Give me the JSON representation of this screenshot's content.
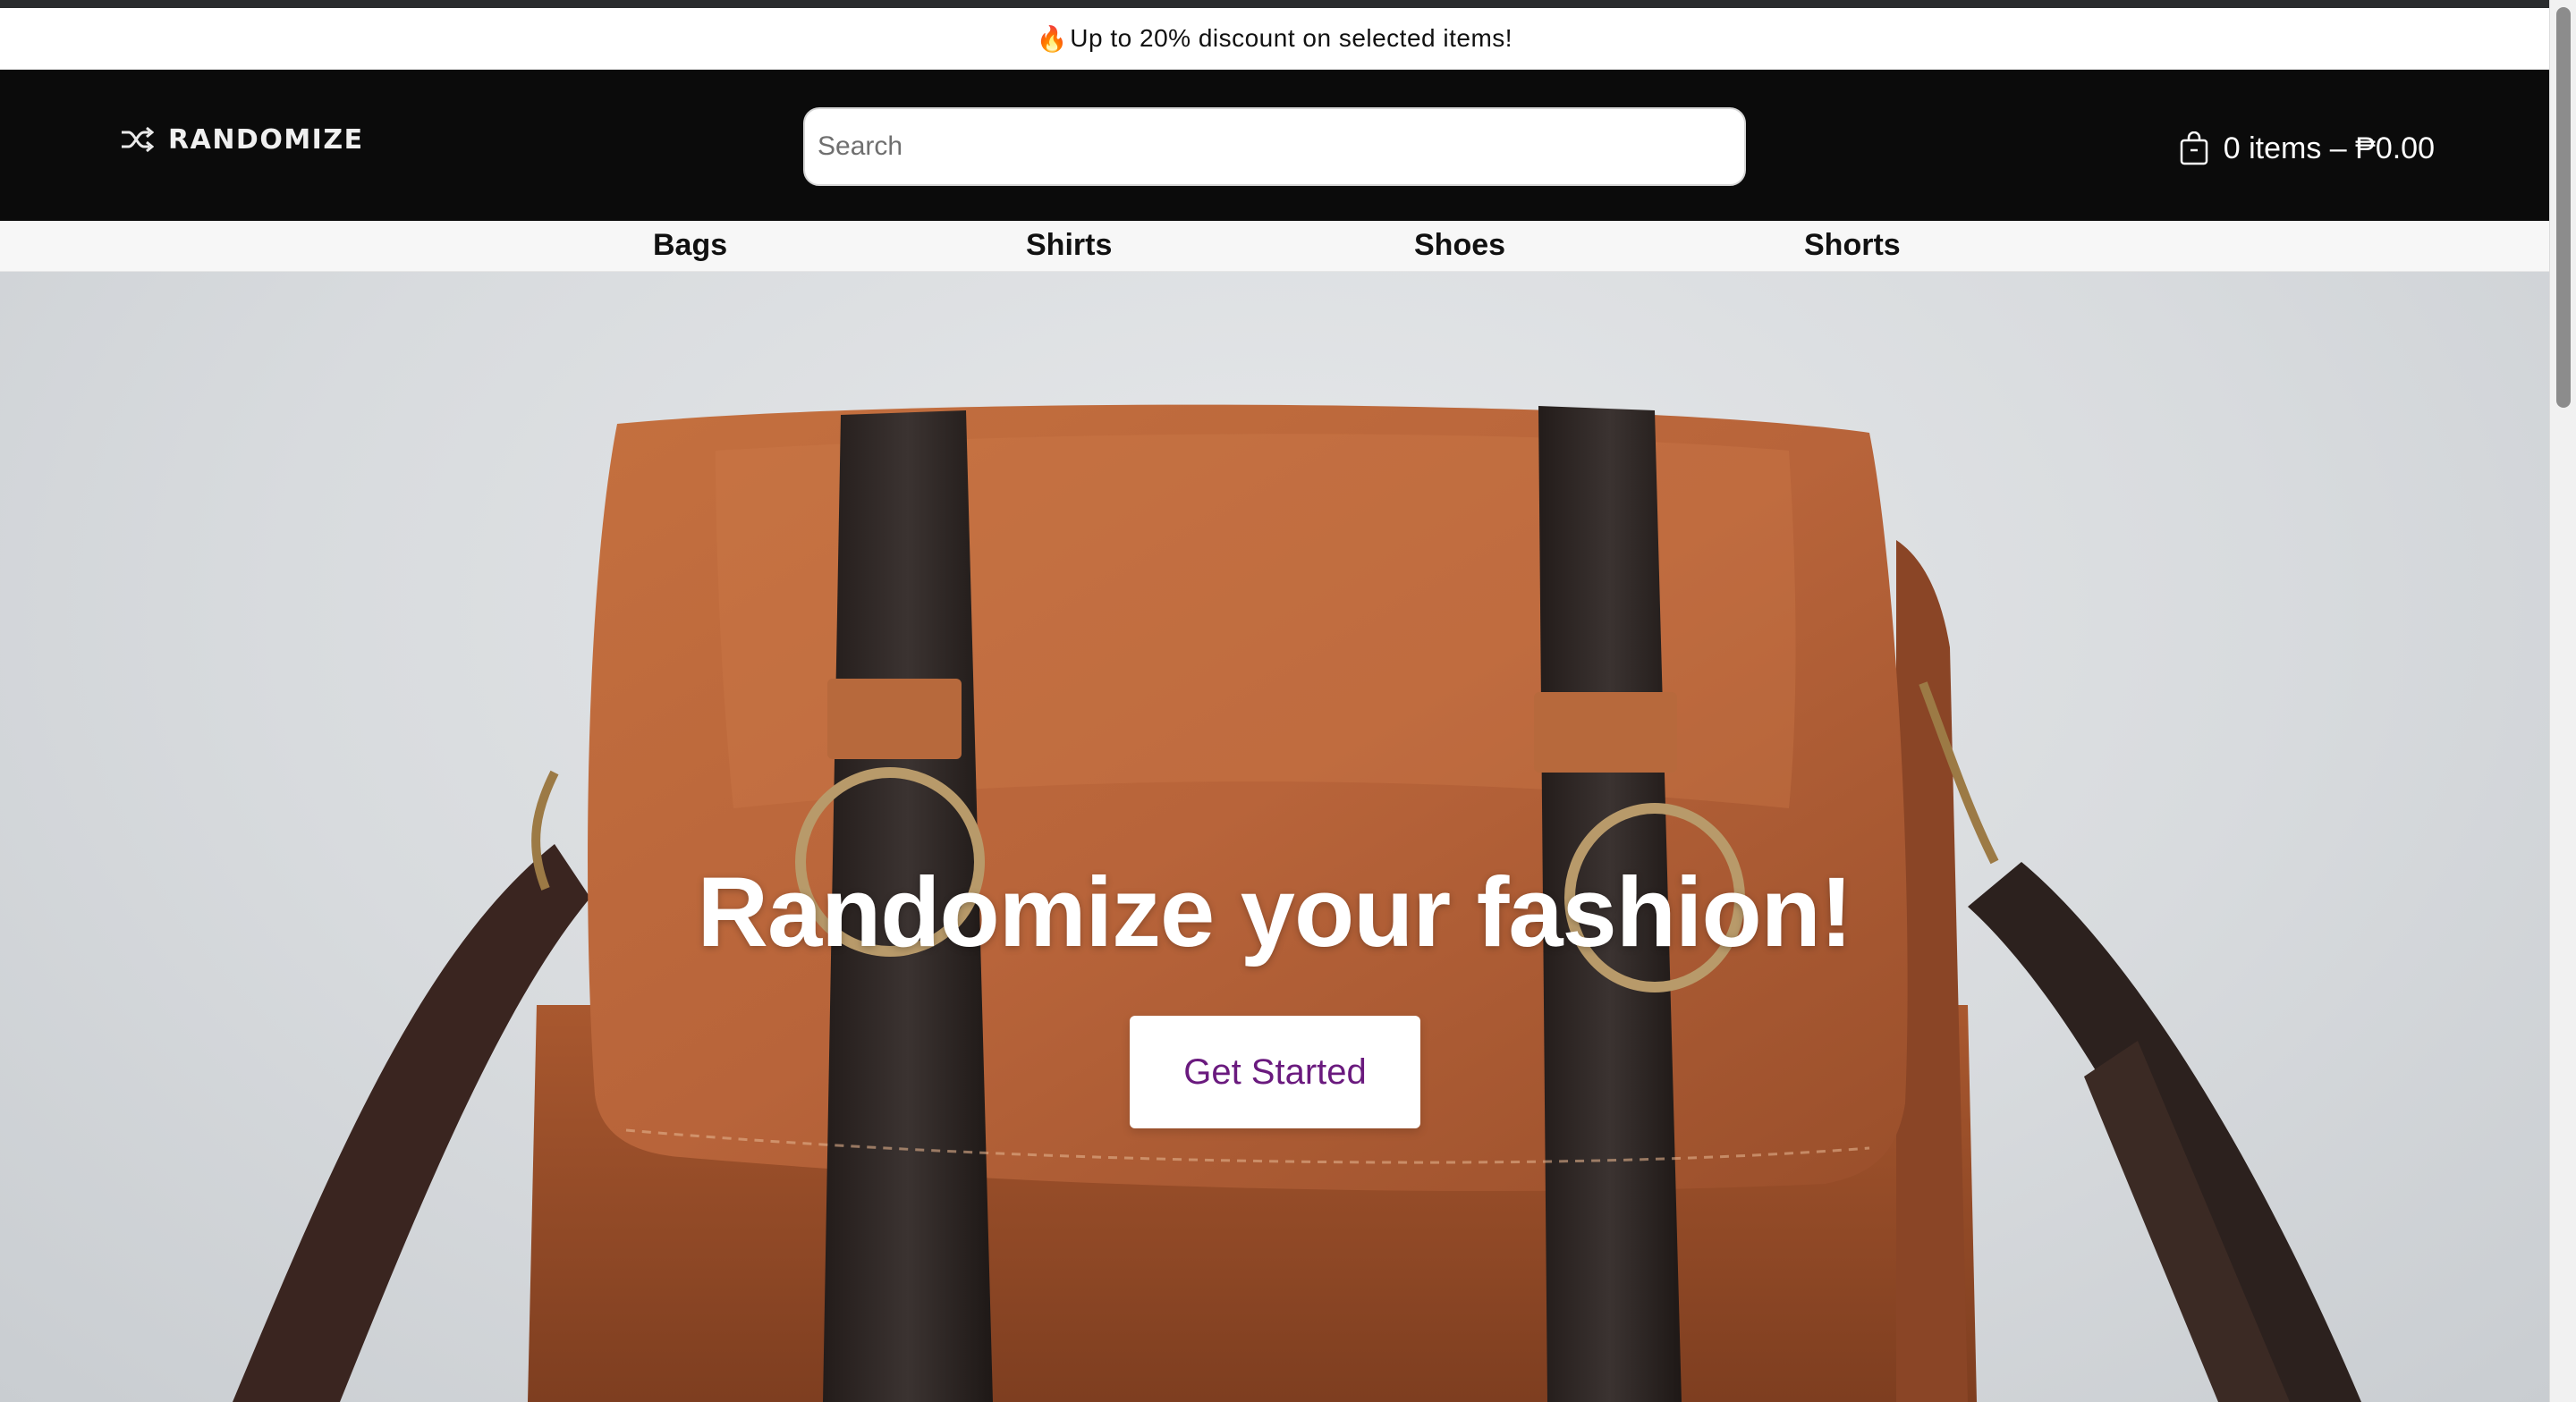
{
  "promo": {
    "icon": "fire-icon",
    "text": "Up to 20% discount on selected items!"
  },
  "header": {
    "logo_icon": "shuffle-icon",
    "logo_text": "RANDOMIZE",
    "search_placeholder": "Search",
    "cart_icon": "shopping-bag-icon",
    "cart_text": "0 items – ₱0.00"
  },
  "nav": {
    "items": [
      {
        "label": "Bags"
      },
      {
        "label": "Shirts"
      },
      {
        "label": "Shoes"
      },
      {
        "label": "Shorts"
      }
    ]
  },
  "hero": {
    "title": "Randomize your fashion!",
    "cta_label": "Get Started"
  },
  "colors": {
    "header_bg": "#0b0b0b",
    "cta_text": "#6a1a7e",
    "bag_leather": "#b8643a",
    "strap": "#2e2624"
  }
}
